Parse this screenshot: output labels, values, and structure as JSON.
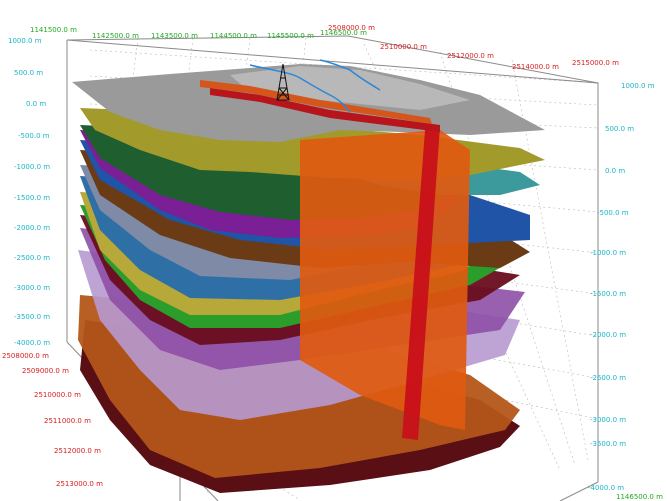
{
  "scene": {
    "colors": {
      "label_red": "#d81e1e",
      "label_green": "#22a822",
      "label_cyan": "#1ab6c8",
      "box": "#8a8a8a",
      "grid": "#b9b9b9"
    },
    "left_depth_labels": [
      "1000.0 m",
      "500.0 m",
      "0.0 m",
      "-500.0 m",
      "-1000.0 m",
      "-1500.0 m",
      "-2000.0 m",
      "-2500.0 m",
      "-3000.0 m",
      "-3500.0 m",
      "-4000.0 m"
    ],
    "right_depth_labels": [
      "1000.0 m",
      "500.0 m",
      "0.0 m",
      "-500.0 m",
      "-1000.0 m",
      "-1500.0 m",
      "-2000.0 m",
      "-2500.0 m",
      "-3000.0 m",
      "-3500.0 m",
      "-4000.0 m"
    ],
    "top_x_labels": [
      "1141500.0 m",
      "1142500.0 m",
      "1143500.0 m",
      "1144500.0 m",
      "1145500.0 m",
      "1146500.0 m"
    ],
    "top_y_labels": [
      "2508000.0 m",
      "2510000.0 m",
      "2512000.0 m",
      "2514000.0 m",
      "2515000.0 m"
    ],
    "bottom_y_labels": [
      "2508000.0 m",
      "2509000.0 m",
      "2510000.0 m",
      "2511000.0 m",
      "2512000.0 m",
      "2513000.0 m"
    ],
    "bottom_corner_label": "1146500.0 m",
    "layers": [
      {
        "name": "surface-topography",
        "color": "#8f8f8f"
      },
      {
        "name": "horizon-olive",
        "color": "#a39a2c"
      },
      {
        "name": "horizon-teal",
        "color": "#3d9a9c"
      },
      {
        "name": "horizon-darkgreen",
        "color": "#1f5e2f"
      },
      {
        "name": "horizon-purple",
        "color": "#7a1f96"
      },
      {
        "name": "horizon-blue",
        "color": "#1f54a6"
      },
      {
        "name": "horizon-brown",
        "color": "#6a3b14"
      },
      {
        "name": "horizon-grey",
        "color": "#7f8aa6"
      },
      {
        "name": "horizon-steelblue",
        "color": "#2e6fa6"
      },
      {
        "name": "horizon-yellow",
        "color": "#b7a83a"
      },
      {
        "name": "horizon-green",
        "color": "#2a9d2a"
      },
      {
        "name": "horizon-violet",
        "color": "#8e4fa6"
      },
      {
        "name": "horizon-lavender",
        "color": "#a886c2"
      },
      {
        "name": "horizon-orange",
        "color": "#b4561a"
      },
      {
        "name": "horizon-maroon",
        "color": "#5a0f14"
      }
    ],
    "fault_colors": [
      "#e05a10",
      "#c8101a"
    ]
  }
}
